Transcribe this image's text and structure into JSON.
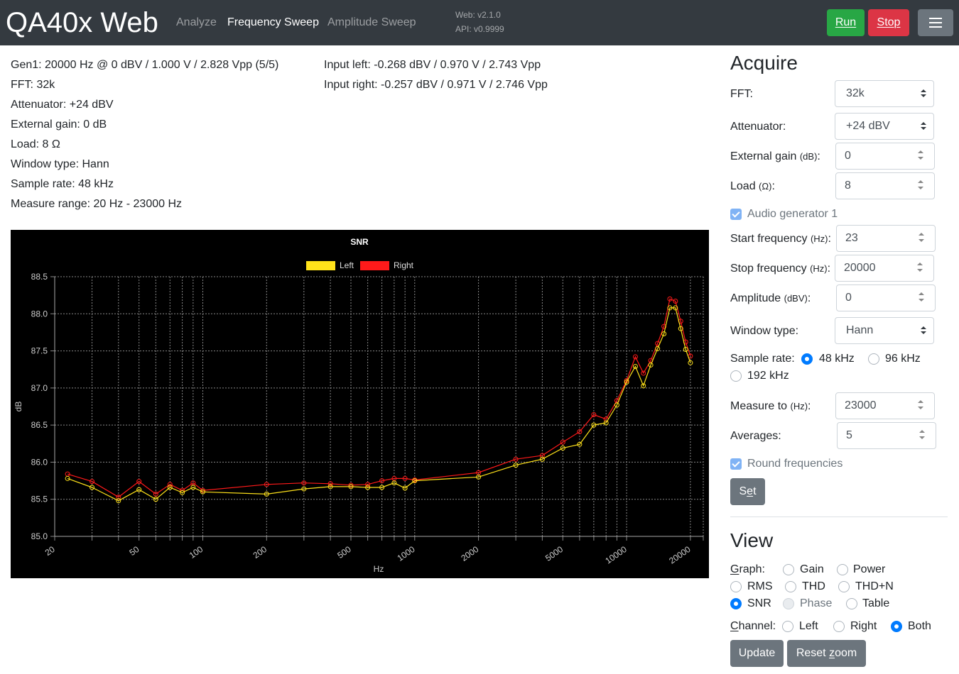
{
  "navbar": {
    "brand": "QA40x Web",
    "links": [
      {
        "label": "Analyze",
        "active": false
      },
      {
        "label": "Frequency Sweep",
        "active": true
      },
      {
        "label": "Amplitude Sweep",
        "active": false
      }
    ],
    "web_version": "Web: v2.1.0",
    "api_version": "API: v0.9999",
    "run_label": "Run",
    "stop_label": "Stop",
    "menu_icon": "hamburger-icon",
    "colors": {
      "run": "#28a745",
      "stop": "#dc3545",
      "bar": "#343a40"
    }
  },
  "info": {
    "gen": "Gen1: 20000 Hz @ 0 dBV / 1.000 V / 2.828 Vpp (5/5)",
    "fft": "FFT: 32k",
    "attenuator": "Attenuator: +24 dBV",
    "external_gain": "External gain: 0 dB",
    "load": "Load: 8 Ω",
    "window": "Window type: Hann",
    "sample_rate": "Sample rate: 48 kHz",
    "measure_range": "Measure range: 20 Hz - 23000 Hz",
    "input_left": "Input left: -0.268 dBV / 0.970 V / 2.743 Vpp",
    "input_right": "Input right: -0.257 dBV / 0.971 V / 2.746 Vpp"
  },
  "chart_data": {
    "type": "line",
    "title": "SNR",
    "xlabel": "Hz",
    "ylabel": "dB",
    "x_scale": "log",
    "xlim": [
      20,
      23000
    ],
    "ylim": [
      85.0,
      88.5
    ],
    "yticks": [
      "88.5",
      "88.0",
      "87.5",
      "87.0",
      "86.5",
      "86.0",
      "85.5",
      "85.0"
    ],
    "xtick_labels": [
      "20",
      "50",
      "100",
      "200",
      "500",
      "1000",
      "2000",
      "5000",
      "10000",
      "20000"
    ],
    "legend_position": "top",
    "grid": true,
    "series": [
      {
        "name": "Left",
        "color": "#ffe21a",
        "points": [
          [
            23,
            85.78
          ],
          [
            30,
            85.66
          ],
          [
            40,
            85.48
          ],
          [
            50,
            85.63
          ],
          [
            60,
            85.5
          ],
          [
            70,
            85.66
          ],
          [
            80,
            85.59
          ],
          [
            90,
            85.66
          ],
          [
            100,
            85.6
          ],
          [
            200,
            85.57
          ],
          [
            300,
            85.64
          ],
          [
            400,
            85.67
          ],
          [
            500,
            85.67
          ],
          [
            600,
            85.66
          ],
          [
            700,
            85.66
          ],
          [
            800,
            85.72
          ],
          [
            900,
            85.65
          ],
          [
            1000,
            85.75
          ],
          [
            2000,
            85.8
          ],
          [
            3000,
            85.96
          ],
          [
            4000,
            86.04
          ],
          [
            5000,
            86.19
          ],
          [
            6000,
            86.24
          ],
          [
            7000,
            86.5
          ],
          [
            8000,
            86.53
          ],
          [
            9000,
            86.77
          ],
          [
            10000,
            87.08
          ],
          [
            11000,
            87.29
          ],
          [
            12000,
            87.03
          ],
          [
            13000,
            87.31
          ],
          [
            14000,
            87.53
          ],
          [
            15000,
            87.73
          ],
          [
            16000,
            88.08
          ],
          [
            17000,
            88.08
          ],
          [
            18000,
            87.8
          ],
          [
            19000,
            87.52
          ],
          [
            20000,
            87.34
          ]
        ]
      },
      {
        "name": "Right",
        "color": "#ff1a1a",
        "points": [
          [
            23,
            85.84
          ],
          [
            30,
            85.74
          ],
          [
            40,
            85.53
          ],
          [
            50,
            85.74
          ],
          [
            60,
            85.57
          ],
          [
            70,
            85.7
          ],
          [
            80,
            85.62
          ],
          [
            90,
            85.72
          ],
          [
            100,
            85.62
          ],
          [
            200,
            85.7
          ],
          [
            300,
            85.72
          ],
          [
            400,
            85.71
          ],
          [
            500,
            85.69
          ],
          [
            600,
            85.7
          ],
          [
            700,
            85.75
          ],
          [
            800,
            85.78
          ],
          [
            900,
            85.78
          ],
          [
            1000,
            85.76
          ],
          [
            2000,
            85.86
          ],
          [
            3000,
            86.04
          ],
          [
            4000,
            86.09
          ],
          [
            5000,
            86.27
          ],
          [
            6000,
            86.41
          ],
          [
            7000,
            86.64
          ],
          [
            8000,
            86.58
          ],
          [
            9000,
            86.83
          ],
          [
            10000,
            87.1
          ],
          [
            11000,
            87.42
          ],
          [
            12000,
            87.2
          ],
          [
            13000,
            87.37
          ],
          [
            14000,
            87.6
          ],
          [
            15000,
            87.83
          ],
          [
            16000,
            88.2
          ],
          [
            17000,
            88.17
          ],
          [
            18000,
            87.9
          ],
          [
            19000,
            87.62
          ],
          [
            20000,
            87.43
          ]
        ]
      }
    ]
  },
  "acquire": {
    "heading": "Acquire",
    "fft_label": "FFT:",
    "fft_value": "32k",
    "attenuator_label": "Attenuator:",
    "attenuator_value": "+24 dBV",
    "external_gain_label": "External gain",
    "external_gain_unit": "(dB)",
    "external_gain_value": "0",
    "load_label": "Load",
    "load_unit": "(Ω)",
    "load_value": "8",
    "audio_gen_label": "Audio generator 1",
    "start_freq_label": "Start frequency",
    "start_freq_unit": "(Hz)",
    "start_freq_value": "23",
    "stop_freq_label": "Stop frequency",
    "stop_freq_unit": "(Hz)",
    "stop_freq_value": "20000",
    "amplitude_label": "Amplitude",
    "amplitude_unit": "(dBV)",
    "amplitude_value": "0",
    "window_label": "Window type:",
    "window_value": "Hann",
    "sample_rate_label": "Sample rate:",
    "sr_48": "48 kHz",
    "sr_96": "96 kHz",
    "sr_192": "192 kHz",
    "measure_to_label": "Measure to",
    "measure_to_unit": "(Hz)",
    "measure_to_value": "23000",
    "averages_label": "Averages:",
    "averages_value": "5",
    "round_label": "Round frequencies",
    "set_label_pre": "S",
    "set_label_u": "e",
    "set_label_post": "t"
  },
  "view": {
    "heading": "View",
    "graph_label_u": "G",
    "graph_label_rest": "raph:",
    "gain": "Gain",
    "power": "Power",
    "rms": "RMS",
    "thd": "THD",
    "thdn": "THD+N",
    "snr": "SNR",
    "phase": "Phase",
    "table": "Table",
    "channel_label_u": "C",
    "channel_label_rest": "hannel:",
    "left": "Left",
    "right": "Right",
    "both": "Both",
    "update_label": "Update",
    "reset_pre": "Reset ",
    "reset_u": "z",
    "reset_post": "oom"
  }
}
